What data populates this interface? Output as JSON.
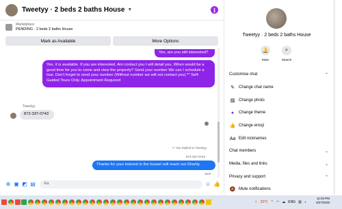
{
  "header": {
    "title": "Tweetyy · 2 beds 2 baths House"
  },
  "marketplace": {
    "label": "Marketplace",
    "status": "PENDING · 2 beds 2 baths House"
  },
  "actions": {
    "mark_available": "Mark as Available",
    "more_options": "More Options"
  },
  "messages": {
    "m1": "Yes, are you still interested?",
    "m2": "Yes, it is available. If you are interested.  Am contact you I will detail you.  When would be a good time for you to come and view the property? Send your number We can I schedule a tour.  Don't forget to send your number (Without number we will not contact you).** Self-Guided Tours Only. Appointment Required",
    "sender": "Tweetyy",
    "m3": "872-337-0743",
    "replied_note": "You replied to Tweetyy",
    "quoted": "872-337-0743",
    "m4": "Thanks for your interest in the house! will reach out Shortly.",
    "sent": "Sent"
  },
  "composer": {
    "placeholder": "Aa"
  },
  "panel": {
    "title": "Tweetyy · 2 beds 2 baths House",
    "mute": "Mute",
    "search": "Search",
    "customise": "Customise chat",
    "change_chat_name": "Change chat name",
    "change_photo": "Change photo",
    "change_theme": "Change theme",
    "change_emoji": "Change emoji",
    "edit_nicknames_icon": "Aa",
    "edit_nicknames": "Edit nicknames",
    "chat_members": "Chat members",
    "media": "Media, files and links",
    "privacy": "Privacy and support",
    "mute_notifications": "Mute notifications"
  },
  "taskbar": {
    "temp": "23°C",
    "lang": "ENG",
    "time": "11:03 PM",
    "date": "3/27/2025"
  },
  "colors": {
    "accent_purple": "#8e24e8",
    "accent_blue": "#1d76f2"
  }
}
